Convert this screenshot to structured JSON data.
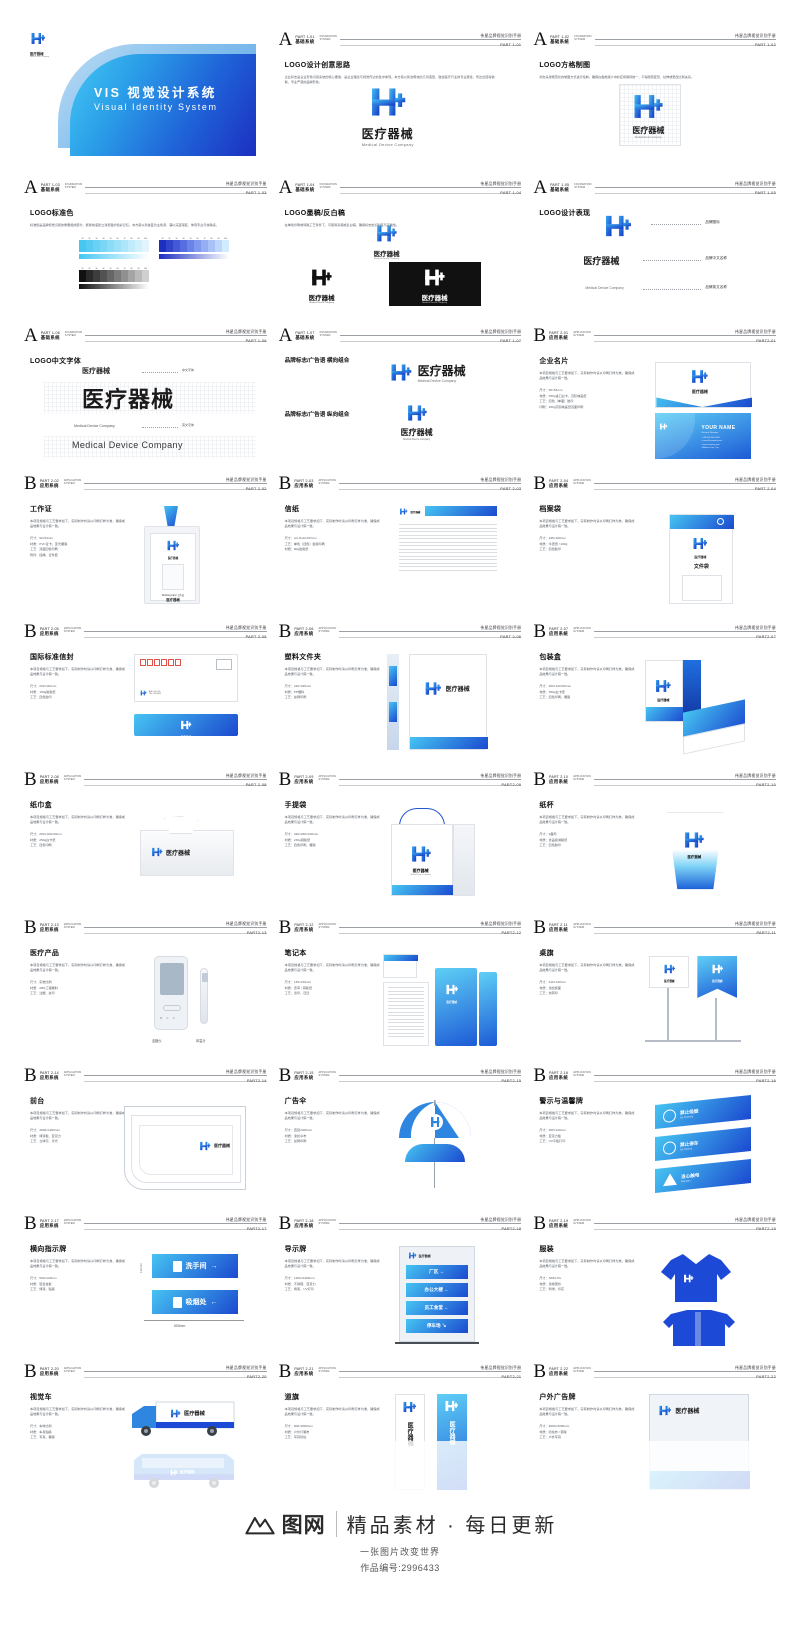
{
  "document": {
    "cover_title_cn": "VIS 视觉设计系统",
    "cover_title_en": "Visual Identity System",
    "manual_label": "伟星品牌视觉识别手册",
    "section_a_cn": "基础系统",
    "section_a_en1": "FOUNDATION",
    "section_a_en2": "SYSTEM",
    "section_b_cn": "应用系统",
    "section_b_en1": "APPLICATION",
    "section_b_en2": "SYSTEM"
  },
  "brand": {
    "name_cn": "医疗器械",
    "name_en": "Medical Device Company",
    "colors": {
      "cyan": "#45c7f2",
      "blue": "#1b49cf",
      "deep": "#1c2fc0",
      "black": "#111111"
    }
  },
  "body_text": {
    "p1": "企业标志是企业形象识别系统的核心要素，是企业理念与视觉传达的集中体现。本方案以简洁明快的几何造型，融合医疗行业的专业属性，传达出值得信赖、专业严谨的品牌形象。",
    "p2": "标志采用规范化的制图方式进行绘制，确保在各类媒介中的应用保持统一，不得随意变形、拉伸或更改比例关系。",
    "p3": "标准色是品牌视觉识别的重要组成部分，能够快速建立消费者的色彩记忆。本方案以科技蓝为主色调，辅以深蓝渐变，体现专业与信赖感。",
    "p4": "在单色印刷或特殊工艺条件下，可使用墨稿或反白稿，确保标志的识别度与完整性。",
    "p5": "本项目规格与工艺要求如下，实际制作时请以印刷打样为准，确保成品效果与设计稿一致。"
  },
  "swatches": {
    "cyan_steps": [
      "#45c7f2",
      "#56ccf3",
      "#68d1f4",
      "#79d6f5",
      "#8bdcf7",
      "#9ce1f8",
      "#aee6f9",
      "#bfebfa",
      "#d1f0fb",
      "#e2f5fd"
    ],
    "blue_steps": [
      "#1b2fc0",
      "#2f44cb",
      "#4359d6",
      "#576ee0",
      "#6b83e8",
      "#8098ee",
      "#94adf3",
      "#a8c2f7",
      "#bcd7fb",
      "#d0ecfe"
    ],
    "black_steps": [
      "#111111",
      "#2a2a2a",
      "#3d3d3d",
      "#525252",
      "#666666",
      "#7b7b7b",
      "#909090",
      "#a5a5a5",
      "#bababa",
      "#cfcfcf"
    ],
    "tick_labels": [
      "10",
      "20",
      "30",
      "40",
      "50",
      "60",
      "70",
      "80",
      "90",
      "100"
    ]
  },
  "pages": [
    {
      "kind": "cover",
      "letter": "A",
      "part": "PART 1-01",
      "part_right": "PART 1-01",
      "title": ""
    },
    {
      "kind": "logo-idea",
      "letter": "A",
      "part": "PART 1-01",
      "part_right": "PART 1-01",
      "title": "LOGO设计创意思路"
    },
    {
      "kind": "logo-grid",
      "letter": "A",
      "part": "PART 1-02",
      "part_right": "PART 1-02",
      "title": "LOGO方格制图"
    },
    {
      "kind": "logo-color",
      "letter": "A",
      "part": "PART 1-03",
      "part_right": "PART 1-03",
      "title": "LOGO标准色"
    },
    {
      "kind": "logo-mono",
      "letter": "A",
      "part": "PART 1-04",
      "part_right": "PART 1-04",
      "title": "LOGO墨稿/反白稿"
    },
    {
      "kind": "logo-express",
      "letter": "A",
      "part": "PART 1-05",
      "part_right": "PART 1-05",
      "title": "LOGO设计表现",
      "anno": [
        "品牌图标",
        "品牌中文名称",
        "品牌英文名称"
      ]
    },
    {
      "kind": "logo-font-cn",
      "letter": "A",
      "part": "PART 1-06",
      "part_right": "PART 1-06",
      "title": "LOGO中文字体",
      "anno": [
        "中文字体",
        "英文字体"
      ]
    },
    {
      "kind": "logo-lockup",
      "letter": "A",
      "part": "PART 1-07",
      "part_right": "PART 1-07",
      "title": "",
      "sub1": "品牌标志/广告语 横向组合",
      "sub2": "品牌标志/广告语 纵向组合"
    },
    {
      "kind": "namecard",
      "letter": "B",
      "part": "PART 2-01",
      "part_right": "PART2-01",
      "title": "企业名片",
      "specs": [
        "尺寸：90×54mm",
        "材质：250g进口白卡、高阶映画纸",
        "工艺：四色（单面）胶印",
        "印刷：250g高阶映画纸双面印刷"
      ],
      "card_name": "YOUR NAME"
    },
    {
      "kind": "workcard",
      "letter": "B",
      "part": "PART 2-02",
      "part_right": "PART 2-02",
      "title": "工作证",
      "specs": [
        "尺寸：90×54mm",
        "材质：PVC证卡、亚光覆膜",
        "工艺：双面四色印刷",
        "附件：挂绳、证件套"
      ],
      "label_en": "Working Card 工作证",
      "label_cn": "医疗器械"
    },
    {
      "kind": "letterhead",
      "letter": "B",
      "part": "PART 2-03",
      "part_right": "PART 2-03",
      "title": "信纸",
      "specs": [
        "尺寸：A4 /210×297mm",
        "工艺：单色（四色）胶版印刷",
        "材质：80g胶版纸"
      ]
    },
    {
      "kind": "envelope-file",
      "letter": "B",
      "part": "PART 2-04",
      "part_right": "PART 2-04",
      "title": "档案袋",
      "specs": [
        "尺寸：235×320mm",
        "材质：牛皮纸 / 200g",
        "工艺：四色胶印"
      ],
      "label_cn": "文件袋"
    },
    {
      "kind": "envelope-std",
      "letter": "B",
      "part": "PART 2-05",
      "part_right": "PART 2-05",
      "title": "国际标准信封",
      "specs": [
        "尺寸：220×110mm",
        "材质：100g胶版纸",
        "工艺：四色胶印"
      ]
    },
    {
      "kind": "plastic-folder",
      "letter": "B",
      "part": "PART 2-06",
      "part_right": "PART 2-06",
      "title": "塑料文件夹",
      "specs": [
        "尺寸：240×320mm",
        "材质：PP塑料",
        "工艺：丝网印刷"
      ]
    },
    {
      "kind": "package-box",
      "letter": "B",
      "part": "PART 2-07",
      "part_right": "PART2-07",
      "title": "包装盒",
      "specs": [
        "尺寸：200×120×60mm",
        "材质：350g白卡纸",
        "工艺：四色印刷、覆膜"
      ]
    },
    {
      "kind": "tissue-box",
      "letter": "B",
      "part": "PART 2-08",
      "part_right": "PART 2-08",
      "title": "纸巾盒",
      "specs": [
        "尺寸：200×100×60mm",
        "材质：250g白卡纸",
        "工艺：四色印刷"
      ]
    },
    {
      "kind": "handbag",
      "letter": "B",
      "part": "PART 2-09",
      "part_right": "PART2-09",
      "title": "手提袋",
      "specs": [
        "尺寸：320×260×100mm",
        "材质：230g铜版纸",
        "工艺：四色印刷、覆膜"
      ]
    },
    {
      "kind": "papercup",
      "letter": "B",
      "part": "PART 2-10",
      "part_right": "PART2-10",
      "title": "纸杯",
      "specs": [
        "尺寸：9盎司",
        "材质：食品级淋膜纸",
        "工艺：四色胶印"
      ]
    },
    {
      "kind": "medical-product",
      "letter": "B",
      "part": "PART 2-13",
      "part_right": "PART2-13",
      "title": "医疗产品",
      "specs": [
        "尺寸：实物比例",
        "材质：ABS工程塑料",
        "工艺：注塑、丝印"
      ],
      "anno": [
        "血糖仪",
        "体温计"
      ]
    },
    {
      "kind": "notebook",
      "letter": "B",
      "part": "PART 2-12",
      "part_right": "PART2-12",
      "title": "笔记本",
      "specs": [
        "尺寸：145×210mm",
        "材质：皮革 / 铜版纸",
        "工艺：烫印、压凹"
      ]
    },
    {
      "kind": "deskflag",
      "letter": "B",
      "part": "PART 2-11",
      "part_right": "PART2-11",
      "title": "桌旗",
      "specs": [
        "尺寸：210×140mm",
        "材质：涤纶旗面",
        "工艺：热转印"
      ]
    },
    {
      "kind": "reception",
      "letter": "B",
      "part": "PART 2-14",
      "part_right": "PART2-14",
      "title": "前台",
      "specs": [
        "尺寸：3000×1200mm",
        "材质：烤漆板、亚克力",
        "工艺：立体字、背光"
      ]
    },
    {
      "kind": "umbrella",
      "letter": "B",
      "part": "PART 2-15",
      "part_right": "PART2-15",
      "title": "广告伞",
      "specs": [
        "尺寸：直径2400mm",
        "材质：涤纶伞布",
        "工艺：丝网印刷"
      ]
    },
    {
      "kind": "warning-signs",
      "letter": "B",
      "part": "PART 2-16",
      "part_right": "PART2-16",
      "title": "警示与温馨牌",
      "specs": [
        "尺寸：300×120mm",
        "材质：亚克力板",
        "工艺：UV平板打印"
      ],
      "signs": [
        {
          "cn": "禁止吸烟",
          "en": "No Smoking"
        },
        {
          "cn": "禁止停车",
          "en": "No Parking"
        },
        {
          "cn": "当心触电",
          "en": "Attention"
        }
      ]
    },
    {
      "kind": "direction-sign",
      "letter": "B",
      "part": "PART 2-17",
      "part_right": "PART2-17",
      "title": "横向指示牌",
      "specs": [
        "尺寸：500×120mm",
        "材质：铝合金板",
        "工艺：烤漆、贴膜"
      ],
      "signs": [
        "洗手间",
        "吸烟处"
      ],
      "dim": "500mm"
    },
    {
      "kind": "pylon-sign",
      "letter": "B",
      "part": "PART 2-18",
      "part_right": "PART2-18",
      "title": "导示牌",
      "specs": [
        "尺寸：1200×2400mm",
        "材质：不锈钢、亚克力",
        "工艺：烤漆、UV打印"
      ],
      "rows": [
        "厂区 →",
        "办公大楼 ←",
        "员工食堂 ←",
        "停车场 ↘"
      ]
    },
    {
      "kind": "uniform",
      "letter": "B",
      "part": "PART 2-19",
      "part_right": "PART2-19",
      "title": "服装",
      "specs": [
        "尺寸：S/M/L/XL",
        "材质：涤棉混纺",
        "工艺：刺绣、印花"
      ]
    },
    {
      "kind": "vehicle",
      "letter": "B",
      "part": "PART 2-20",
      "part_right": "PART2-20",
      "title": "视觉车",
      "specs": [
        "尺寸：车体比例",
        "材质：车身贴膜",
        "工艺：写真、覆膜"
      ]
    },
    {
      "kind": "flag",
      "letter": "B",
      "part": "PART 2-21",
      "part_right": "PART2-21",
      "title": "道旗",
      "specs": [
        "尺寸：800×2000mm",
        "材质：户外灯箱布",
        "工艺：写真喷绘"
      ]
    },
    {
      "kind": "outdoor-ad",
      "letter": "B",
      "part": "PART 2-22",
      "part_right": "PART2-22",
      "title": "户外广告牌",
      "specs": [
        "尺寸：6000×3000mm",
        "材质：喷绘布 / 钢架",
        "工艺：户外写真"
      ]
    }
  ],
  "watermark": {
    "brand": "图网",
    "tagline": "精品素材 · 每日更新",
    "subline": "一张图片改变世界",
    "id_label": "作品编号:2996433"
  }
}
